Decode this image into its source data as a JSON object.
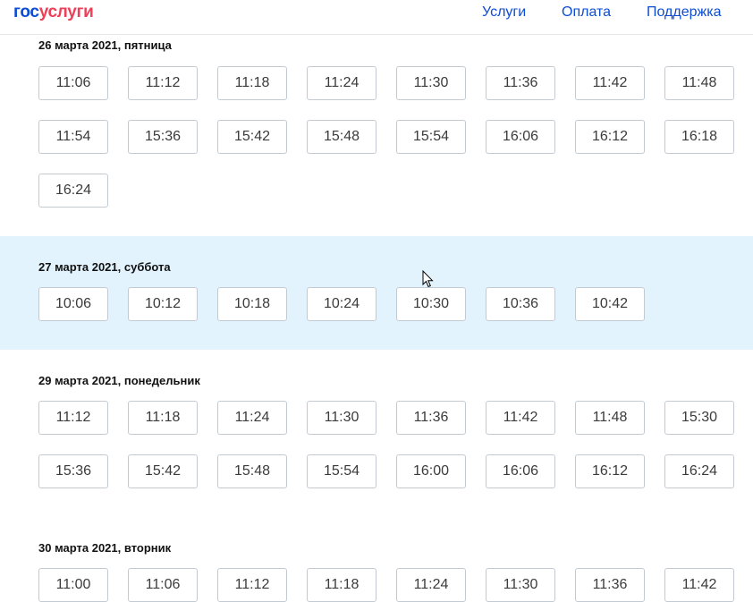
{
  "header": {
    "logo_part1": "гос",
    "logo_part2": "услуги",
    "nav": [
      "Услуги",
      "Оплата",
      "Поддержка"
    ]
  },
  "days": [
    {
      "date": "26 марта 2021, пятница",
      "highlighted": false,
      "slots": [
        "11:06",
        "11:12",
        "11:18",
        "11:24",
        "11:30",
        "11:36",
        "11:42",
        "11:48",
        "11:54",
        "15:36",
        "15:42",
        "15:48",
        "15:54",
        "16:06",
        "16:12",
        "16:18",
        "16:24"
      ]
    },
    {
      "date": "27 марта 2021, суббота",
      "highlighted": true,
      "slots": [
        "10:06",
        "10:12",
        "10:18",
        "10:24",
        "10:30",
        "10:36",
        "10:42"
      ]
    },
    {
      "date": "29 марта 2021, понедельник",
      "highlighted": false,
      "slots": [
        "11:12",
        "11:18",
        "11:24",
        "11:30",
        "11:36",
        "11:42",
        "11:48",
        "15:30",
        "15:36",
        "15:42",
        "15:48",
        "15:54",
        "16:00",
        "16:06",
        "16:12",
        "16:24"
      ]
    },
    {
      "date": "30 марта 2021, вторник",
      "highlighted": false,
      "slots": [
        "11:00",
        "11:06",
        "11:12",
        "11:18",
        "11:24",
        "11:30",
        "11:36",
        "11:42"
      ]
    }
  ],
  "colors": {
    "brand_blue": "#0d4cd3",
    "brand_red": "#ee3f58",
    "highlight_bg": "#e3f3fd"
  },
  "icons": {
    "cursor": "mouse-pointer-icon"
  }
}
